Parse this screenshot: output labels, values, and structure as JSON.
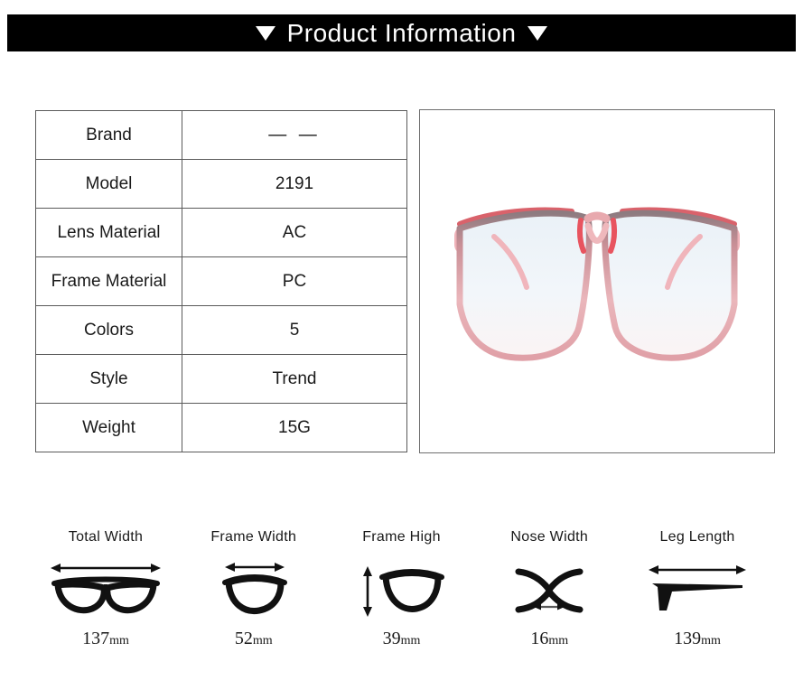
{
  "header": {
    "title": "Product Information",
    "left_marker": "triangle-down",
    "right_marker": "triangle-down",
    "background_color": "#000000",
    "text_color": "#ffffff"
  },
  "spec_table": {
    "rows": [
      {
        "label": "Brand",
        "value": "— —"
      },
      {
        "label": "Model",
        "value": "2191"
      },
      {
        "label": "Lens Material",
        "value": "AC"
      },
      {
        "label": "Frame Material",
        "value": "PC"
      },
      {
        "label": "Colors",
        "value": "5"
      },
      {
        "label": "Style",
        "value": "Trend"
      },
      {
        "label": "Weight",
        "value": "15G"
      }
    ]
  },
  "product_photo": {
    "alt": "pink translucent square eyeglasses front view",
    "frame_color": "#e8a9ae",
    "frame_accent_color": "#d9626b",
    "lens_tint": "#eef4f8"
  },
  "measurements": [
    {
      "label": "Total Width",
      "value": "137",
      "unit": "mm",
      "icon": "full-glasses-icon"
    },
    {
      "label": "Frame Width",
      "value": "52",
      "unit": "mm",
      "icon": "single-lens-icon"
    },
    {
      "label": "Frame High",
      "value": "39",
      "unit": "mm",
      "icon": "lens-height-icon"
    },
    {
      "label": "Nose Width",
      "value": "16",
      "unit": "mm",
      "icon": "nose-bridge-icon"
    },
    {
      "label": "Leg Length",
      "value": "139",
      "unit": "mm",
      "icon": "temple-arm-icon"
    }
  ]
}
